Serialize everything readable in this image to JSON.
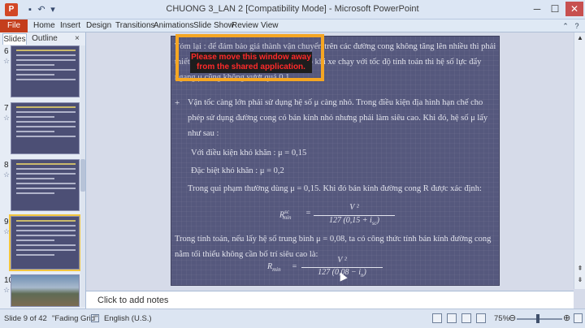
{
  "window": {
    "title": "CHUONG 3_LAN 2 [Compatibility Mode]  -  Microsoft PowerPoint",
    "app_icon": "P",
    "min": "─",
    "max": "☐",
    "close": "✕"
  },
  "ribbon": {
    "file": "File",
    "tabs": [
      "Home",
      "Insert",
      "Design",
      "Transitions",
      "Animations",
      "Slide Show",
      "Review",
      "View"
    ]
  },
  "left_pane": {
    "tabs": [
      "Slides",
      "Outline"
    ],
    "close": "×",
    "slide_numbers": [
      "6",
      "7",
      "8",
      "9",
      "10"
    ]
  },
  "slide": {
    "p1": "Tóm lại : để đảm bảo giá thành vận chuyển trên các đường cong không tăng lên nhiều thì phải thiết kế đường cong có bán kính sao cho khi xe chạy với tốc độ tính toán thì hệ số lực đẩy ngang μ cũng không vượt quá 0,1.",
    "bullet": "+",
    "p2": "Vận tốc càng lớn phải sử dụng hệ số μ càng nhỏ. Trong điều kiện địa hình hạn chế cho phép sử dụng đường cong có bán kính nhỏ nhưng phải làm siêu cao. Khi đó, hệ số μ lấy như sau :",
    "p3": "Với điều kiện khó khăn : μ = 0,15",
    "p4": "Đặc biệt khó khăn : μ = 0,2",
    "p5": "Trong qui phạm thường dùng  μ = 0,15. Khi đó bán kính đường cong R được xác định:",
    "f1_lhs": "R",
    "f1_lhs_sup": "sc",
    "f1_lhs_sub": "min",
    "f1_num": "V ²",
    "f1_den": "127 (0,15 + i",
    "f1_den_sub": "sc",
    "f1_den_end": ")",
    "p6": "Trong tính toán, nếu lấy hệ số trung bình μ = 0,08, ta có công thức tính bán kính đường cong nằm tối thiểu không cần bố trí siêu cao là:",
    "f2_lhs": "R",
    "f2_lhs_sub": "min",
    "f2_eq": "=",
    "f2_num": "V ²",
    "f2_den": "127 (0,08 − i",
    "f2_den_sub": "n",
    "f2_den_end": ")"
  },
  "overlay": {
    "message": "Please move this window away from the shared application."
  },
  "notes": {
    "placeholder": "Click to add notes"
  },
  "status": {
    "slide": "Slide 9 of 42",
    "theme": "\"Fading Grid\"",
    "language": "English (U.S.)",
    "zoom": "75%",
    "zoom_minus": "⊖",
    "zoom_plus": "⊕"
  }
}
